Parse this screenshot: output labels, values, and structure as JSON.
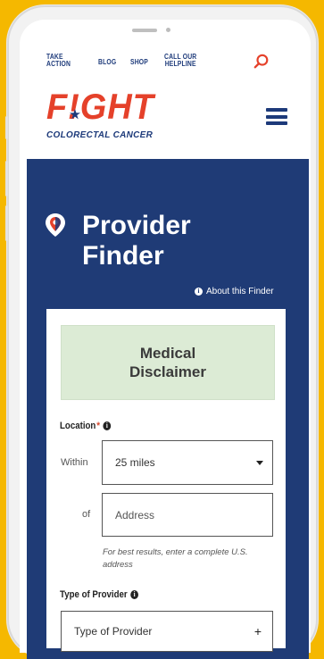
{
  "utility_nav": {
    "take_action": "TAKE\nACTION",
    "blog": "BLOG",
    "shop": "SHOP",
    "helpline": "CALL OUR\nHELPLINE"
  },
  "logo": {
    "main": "F!GHT",
    "sub": "COLORECTAL CANCER"
  },
  "page": {
    "title": "Provider Finder",
    "about": "About this Finder"
  },
  "disclaimer": "Medical Disclaimer",
  "form": {
    "location_label": "Location",
    "required_mark": "*",
    "within_label": "Within",
    "distance_value": "25 miles",
    "of_label": "of",
    "address_placeholder": "Address",
    "address_hint": "For best results, enter a complete U.S. address",
    "provider_label": "Type of Provider",
    "provider_placeholder": "Type of Provider",
    "plus": "+"
  },
  "colors": {
    "brand_red": "#e5412a",
    "brand_navy": "#1d3a7a",
    "panel_navy": "#1f3b76",
    "disclaimer_green": "#dcebd5",
    "background_yellow": "#f5b800"
  }
}
